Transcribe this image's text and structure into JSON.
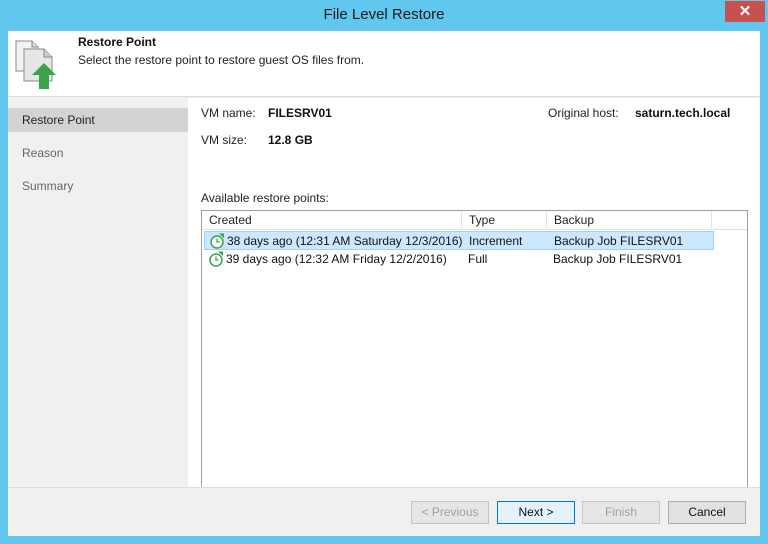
{
  "window": {
    "title": "File Level Restore",
    "close_label": "✕"
  },
  "header": {
    "title": "Restore Point",
    "description": "Select the restore point to restore guest OS files from."
  },
  "sidebar": {
    "items": [
      {
        "label": "Restore Point",
        "active": true
      },
      {
        "label": "Reason",
        "active": false
      },
      {
        "label": "Summary",
        "active": false
      }
    ]
  },
  "main": {
    "vm_name_label": "VM name:",
    "vm_name": "FILESRV01",
    "original_host_label": "Original host:",
    "original_host": "saturn.tech.local",
    "vm_size_label": "VM size:",
    "vm_size": "12.8 GB",
    "list_label": "Available restore points:"
  },
  "table": {
    "columns": [
      "Created",
      "Type",
      "Backup"
    ],
    "rows": [
      {
        "created": "38 days ago (12:31 AM Saturday 12/3/2016)",
        "type": "Increment",
        "backup": "Backup Job FILESRV01",
        "selected": true
      },
      {
        "created": "39 days ago (12:32 AM Friday 12/2/2016)",
        "type": "Full",
        "backup": "Backup Job FILESRV01",
        "selected": false
      }
    ]
  },
  "footer": {
    "previous": "< Previous",
    "next": "Next >",
    "finish": "Finish",
    "cancel": "Cancel"
  },
  "colors": {
    "titlebar": "#61c7ee",
    "close": "#c75050",
    "selection": "#cce8ff",
    "accent_green": "#3aa34a"
  },
  "icons": {
    "header": "restore-documents-icon",
    "row": "restore-point-clock-icon"
  }
}
